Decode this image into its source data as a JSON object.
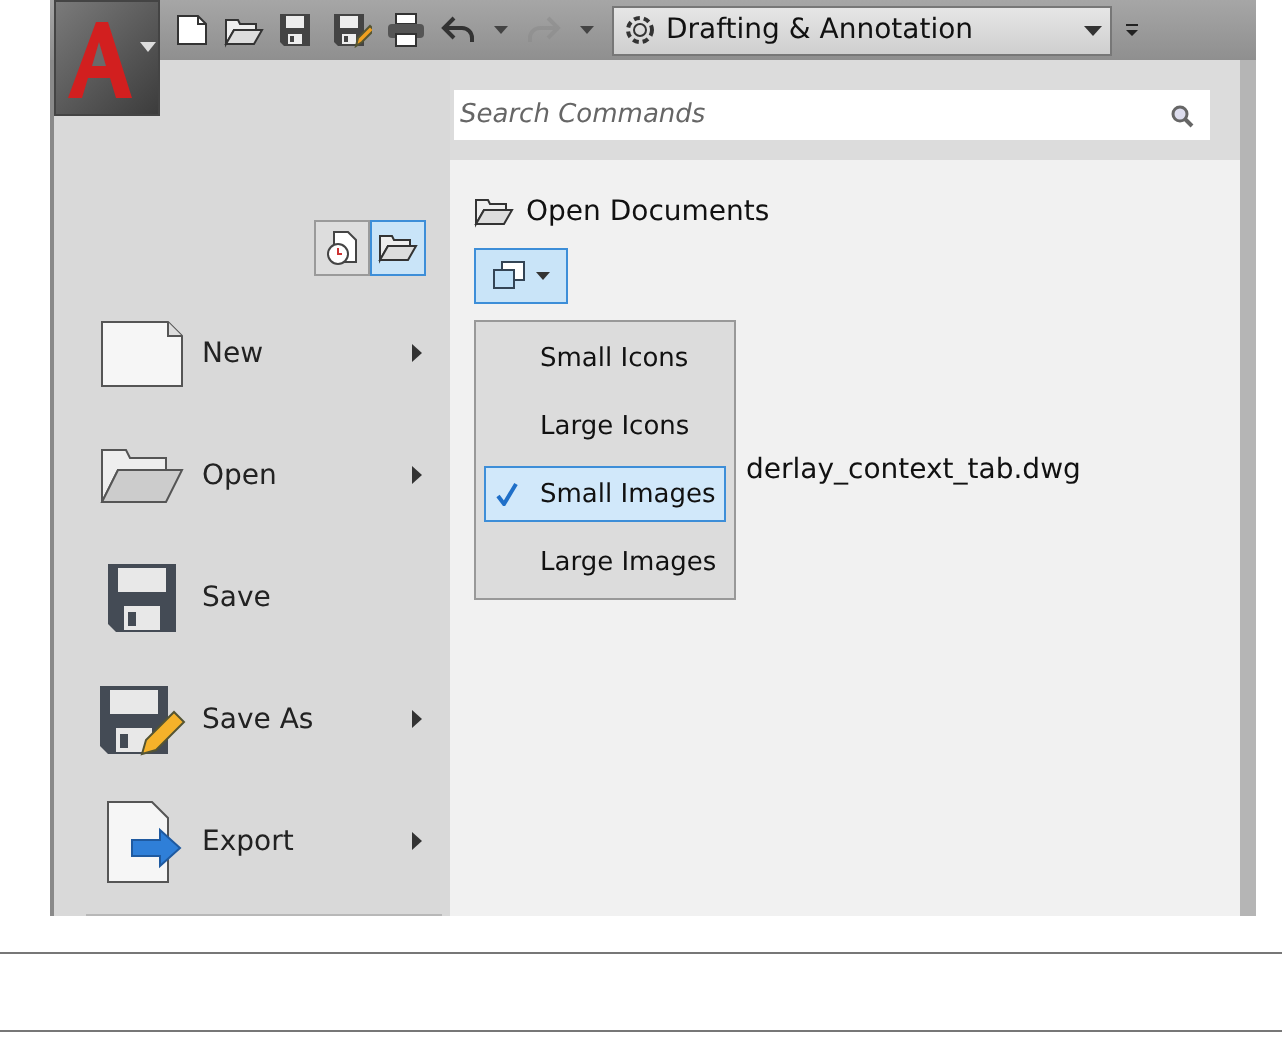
{
  "quick_access": [
    {
      "kind": "new",
      "disabled": false
    },
    {
      "kind": "open",
      "disabled": false
    },
    {
      "kind": "save",
      "disabled": false
    },
    {
      "kind": "saveas",
      "disabled": false
    },
    {
      "kind": "print",
      "disabled": false
    },
    {
      "kind": "undo",
      "disabled": false
    },
    {
      "kind": "redo",
      "disabled": true
    }
  ],
  "workspace": {
    "value": "Drafting & Annotation"
  },
  "search": {
    "placeholder": "Search Commands"
  },
  "view_toggle": [
    {
      "kind": "recent",
      "selected": false
    },
    {
      "kind": "open",
      "selected": true
    }
  ],
  "menu": [
    {
      "kind": "new",
      "label": "New",
      "submenu": true
    },
    {
      "kind": "open",
      "label": "Open",
      "submenu": true
    },
    {
      "kind": "save",
      "label": "Save",
      "submenu": false
    },
    {
      "kind": "saveas",
      "label": "Save As",
      "submenu": true
    },
    {
      "kind": "export",
      "label": "Export",
      "submenu": true
    }
  ],
  "content": {
    "heading": "Open Documents",
    "files": [
      "derlay_context_tab.dwg"
    ]
  },
  "view_menu": [
    {
      "label": "Small Icons",
      "selected": false
    },
    {
      "label": "Large Icons",
      "selected": false
    },
    {
      "label": "Small Images",
      "selected": true
    },
    {
      "label": "Large Images",
      "selected": false
    }
  ]
}
